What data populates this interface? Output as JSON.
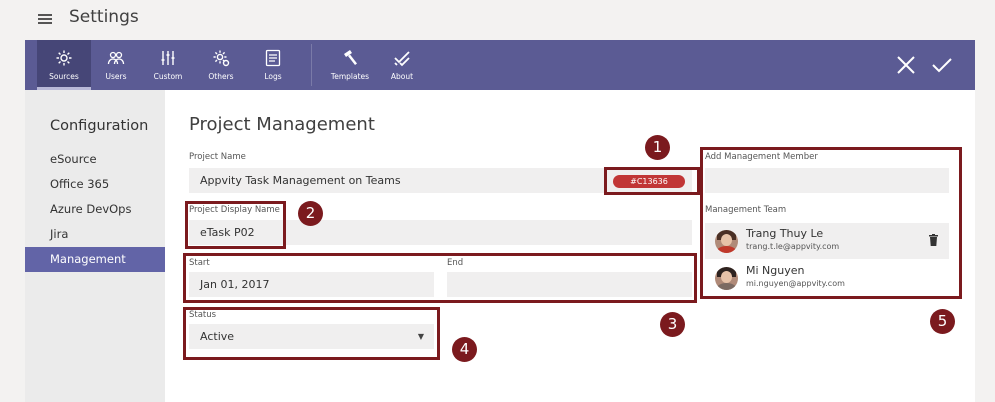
{
  "app": {
    "title": "Settings"
  },
  "toolbar": {
    "tabs": [
      {
        "label": "Sources",
        "icon": "sources-gear-icon",
        "active": true
      },
      {
        "label": "Users",
        "icon": "users-icon"
      },
      {
        "label": "Custom",
        "icon": "custom-sliders-icon"
      },
      {
        "label": "Others",
        "icon": "others-gear-icon"
      },
      {
        "label": "Logs",
        "icon": "logs-icon"
      },
      {
        "label": "Templates",
        "icon": "templates-icon"
      },
      {
        "label": "About",
        "icon": "about-icon"
      }
    ],
    "close_icon": "close-icon",
    "save_icon": "checkmark-icon"
  },
  "nav": {
    "heading": "Configuration",
    "items": [
      {
        "label": "eSource"
      },
      {
        "label": "Office 365"
      },
      {
        "label": "Azure DevOps"
      },
      {
        "label": "Jira"
      },
      {
        "label": "Management",
        "active": true
      }
    ]
  },
  "form": {
    "page_title": "Project Management",
    "project_name_label": "Project Name",
    "project_name_value": "Appvity Task Management on Teams",
    "color_value": "#C13636",
    "display_name_label": "Project Display Name",
    "display_name_value": "eTask P02",
    "start_label": "Start",
    "start_value": "Jan 01, 2017",
    "end_label": "End",
    "end_value": "",
    "status_label": "Status",
    "status_value": "Active"
  },
  "management": {
    "add_member_label": "Add Management Member",
    "add_member_value": "",
    "team_label": "Management Team",
    "members": [
      {
        "name": "Trang Thuy Le",
        "email": "trang.t.le@appvity.com"
      },
      {
        "name": "Mi Nguyen",
        "email": "mi.nguyen@appvity.com"
      }
    ]
  },
  "callouts": [
    "1",
    "2",
    "3",
    "4",
    "5"
  ],
  "colors": {
    "toolbar": "#5b5b94",
    "accent": "#6264a7",
    "callout": "#7b1a1e",
    "project_color": "#c13636"
  }
}
